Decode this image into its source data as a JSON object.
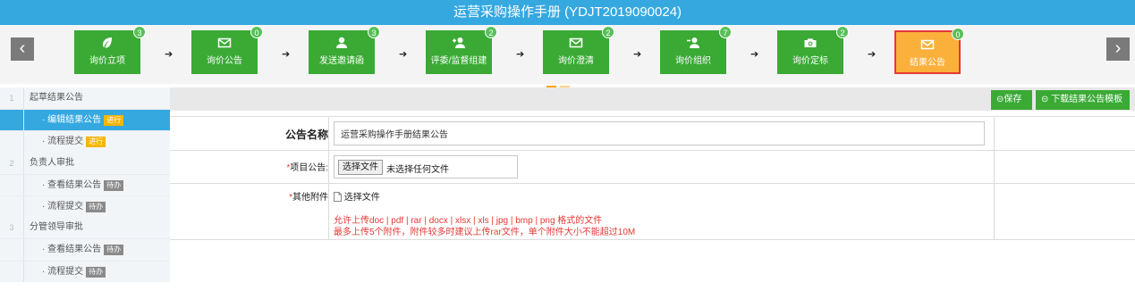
{
  "title": "运营采购操作手册 (YDJT2019090024)",
  "nav": {
    "prev": "‹",
    "next": "›"
  },
  "steps": [
    {
      "label": "询价立项",
      "badge": "3",
      "icon": "leaf-icon"
    },
    {
      "label": "询价公告",
      "badge": "0",
      "icon": "envelope-icon"
    },
    {
      "label": "发送邀请函",
      "badge": "3",
      "icon": "user-icon"
    },
    {
      "label": "评委/监督组建",
      "badge": "2",
      "icon": "user-plus-icon"
    },
    {
      "label": "询价澄清",
      "badge": "2",
      "icon": "envelope-icon"
    },
    {
      "label": "询价组织",
      "badge": "7",
      "icon": "user-minus-icon"
    },
    {
      "label": "询价定标",
      "badge": "2",
      "icon": "camera-icon"
    },
    {
      "label": "结果公告",
      "badge": "0",
      "icon": "envelope-icon",
      "active": true
    }
  ],
  "sidebar": [
    {
      "type": "group",
      "num": "1",
      "label": "起草结果公告"
    },
    {
      "type": "item",
      "label": "· 编辑结果公告",
      "tag": "进行",
      "tag_type": "doing",
      "selected": true
    },
    {
      "type": "item",
      "label": "· 流程提交",
      "tag": "进行",
      "tag_type": "doing"
    },
    {
      "type": "group",
      "num": "2",
      "label": "负责人审批"
    },
    {
      "type": "item",
      "label": "· 查看结果公告",
      "tag": "待办",
      "tag_type": "wait"
    },
    {
      "type": "item",
      "label": "· 流程提交",
      "tag": "待办",
      "tag_type": "wait"
    },
    {
      "type": "group",
      "num": "3",
      "label": "分管领导审批"
    },
    {
      "type": "item",
      "label": "· 查看结果公告",
      "tag": "待办",
      "tag_type": "wait"
    },
    {
      "type": "item",
      "label": "· 流程提交",
      "tag": "待办",
      "tag_type": "wait"
    }
  ],
  "toolbar": {
    "save": "保存",
    "download": "下载结果公告模板"
  },
  "form": {
    "name_label": "公告名称",
    "name_value": "运营采购操作手册结果公告",
    "project_label": "项目公告:",
    "file_button": "选择文件",
    "file_status": "未选择任何文件",
    "attach_label": "其他附件",
    "attach_link": "选择文件",
    "hint_line1": "允许上传doc | pdf | rar | docx | xlsx | xls | jpg | bmp | png 格式的文件",
    "hint_line2": "最多上传5个附件，附件较多时建议上传rar文件，单个附件大小不能超过10M"
  },
  "colors": {
    "header": "#35a8e0",
    "step": "#3aaa35",
    "active_step": "#fbb03b",
    "error": "#e53935"
  }
}
